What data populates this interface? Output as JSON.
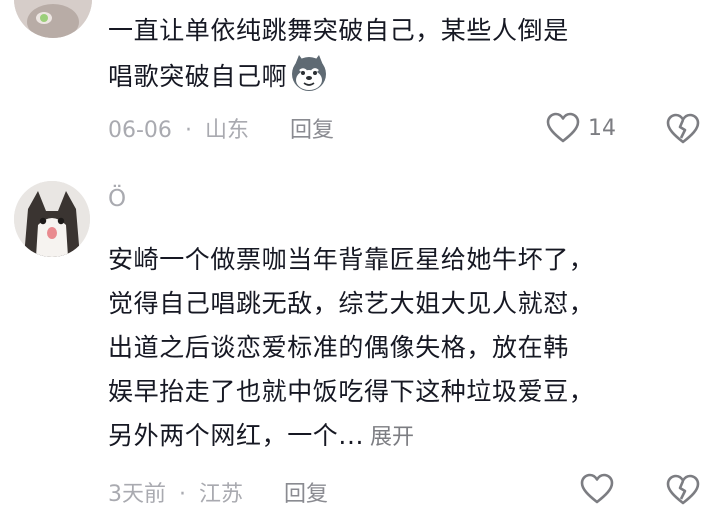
{
  "comments": [
    {
      "text_lines": [
        "一直让单依纯跳舞突破自己，某些人倒是",
        "唱歌突破自己啊"
      ],
      "emoji_icon": "husky-face-icon",
      "date": "06-06",
      "location": "山东",
      "reply_label": "回复",
      "likes": "14"
    },
    {
      "username": "Ö",
      "text_lines": [
        "安崎一个做票咖当年背靠匠星给她牛坏了，",
        "觉得自己唱跳无敌，综艺大姐大见人就怼，",
        "出道之后谈恋爱标准的偶像失格，放在韩",
        "娱早抬走了也就中饭吃得下这种垃圾爱豆，",
        "另外两个网红，一个..."
      ],
      "expand_label": "展开",
      "date": "3天前",
      "location": "江苏",
      "reply_label": "回复"
    }
  ],
  "separator": "·",
  "icons": {
    "like": "heart-outline-icon",
    "dislike": "broken-heart-icon"
  }
}
